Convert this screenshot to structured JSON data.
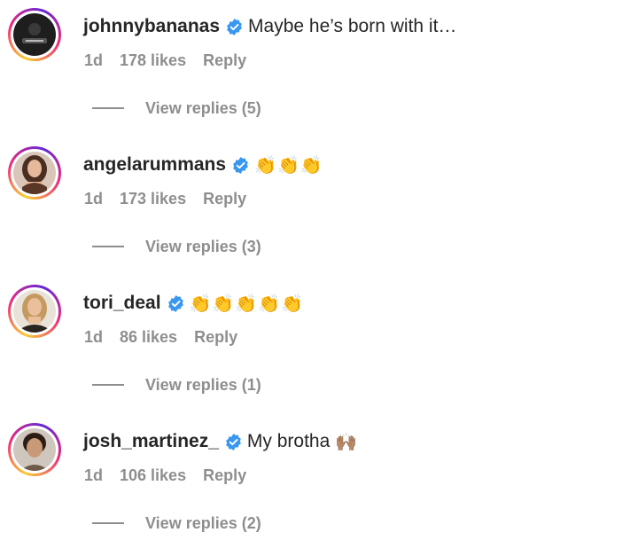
{
  "comments": [
    {
      "username": "johnnybananas",
      "text": "Maybe he’s born with it…",
      "emoji": "",
      "time": "1d",
      "likes": "178 likes",
      "reply": "Reply",
      "view_replies": "View replies (5)",
      "avatar_icon": "avatar-dark-icon"
    },
    {
      "username": "angelarummans",
      "text": "",
      "emoji": "👏👏👏",
      "time": "1d",
      "likes": "173 likes",
      "reply": "Reply",
      "view_replies": "View replies (3)",
      "avatar_icon": "avatar-woman-brunette-icon"
    },
    {
      "username": "tori_deal",
      "text": "",
      "emoji": "👏👏👏👏👏",
      "time": "1d",
      "likes": "86 likes",
      "reply": "Reply",
      "view_replies": "View replies (1)",
      "avatar_icon": "avatar-woman-blonde-icon"
    },
    {
      "username": "josh_martinez_",
      "text": "My brotha",
      "emoji": "🙌🏽",
      "time": "1d",
      "likes": "106 likes",
      "reply": "Reply",
      "view_replies": "View replies (2)",
      "avatar_icon": "avatar-man-curly-icon"
    }
  ],
  "colors": {
    "verified_blue": "#3897f0",
    "meta_gray": "#8e8e8e",
    "text": "#262626"
  }
}
